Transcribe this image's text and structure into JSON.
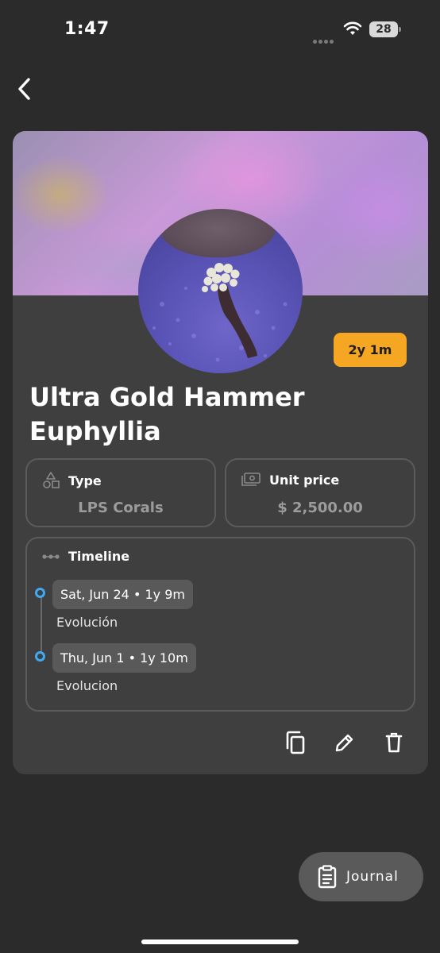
{
  "status_bar": {
    "time": "1:47",
    "battery": "28"
  },
  "card": {
    "age_badge": "2y 1m",
    "title": "Ultra Gold Hammer Euphyllia",
    "type": {
      "label": "Type",
      "value": "LPS Corals"
    },
    "unit_price": {
      "label": "Unit price",
      "value": "$ 2,500.00"
    },
    "timeline": {
      "label": "Timeline",
      "entries": [
        {
          "date": "Sat, Jun 24 • 1y 9m",
          "note": "Evolución"
        },
        {
          "date": "Thu, Jun 1 • 1y 10m",
          "note": "Evolucion"
        }
      ]
    },
    "actions": [
      "copy-icon",
      "edit-icon",
      "delete-icon"
    ]
  },
  "journal_button": {
    "label": "Journal"
  },
  "colors": {
    "background": "#2b2b2b",
    "card": "#3f3f3f",
    "badge": "#f5a623",
    "timeline_dot": "#3fa9f5"
  }
}
